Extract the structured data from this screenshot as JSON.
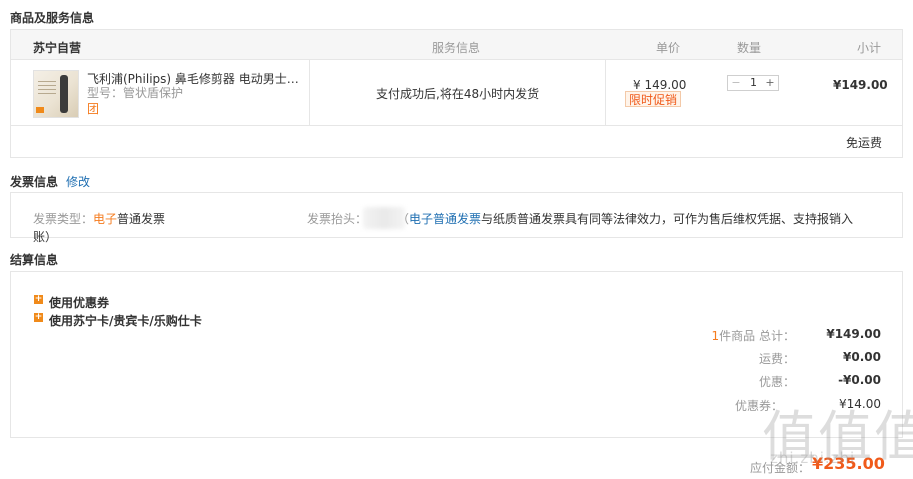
{
  "goods_section": {
    "title": "商品及服务信息",
    "store_name": "苏宁自营",
    "headers": {
      "service": "服务信息",
      "price": "单价",
      "quantity": "数量",
      "subtotal": "小计"
    },
    "item": {
      "name": "飞利浦(Philips) 鼻毛修剪器 电动男士…",
      "model": "型号：管状盾保护",
      "group_tag": "团",
      "service": "支付成功后,将在48小时内发货",
      "price": "¥ 149.00",
      "promo": "限时促销",
      "qty_minus": "−",
      "qty": "1",
      "qty_plus": "+",
      "subtotal": "¥149.00"
    },
    "shipping": "免运费"
  },
  "invoice_section": {
    "title": "发票信息",
    "edit_link": "修改",
    "type_label": "发票类型：",
    "type_value_highlight": "电子",
    "type_value_rest": "普通发票",
    "header_label": "发票抬头：",
    "header_paren": "（",
    "desc_link": "电子普通发票",
    "desc_rest": "与纸质普通发票具有同等法律效力，可作为售后维权凭据、支持报销入",
    "desc_wrap": "账）"
  },
  "settlement_section": {
    "title": "结算信息",
    "coupon": "使用优惠券",
    "card": "使用苏宁卡/贵宾卡/乐购仕卡",
    "item_count_num": "1",
    "item_count_label": "件商品 总计：",
    "total": "¥149.00",
    "freight_label": "运费：",
    "freight": "¥0.00",
    "discount_label": "优惠：",
    "discount": "-¥0.00",
    "coupon_label": "优惠券：",
    "coupon_value": "¥14.00"
  },
  "footer": {
    "payable_label": "应付金额：",
    "payable": "¥235.00"
  },
  "watermark": {
    "big": "值值值",
    "small": "zhi.zhi.zhi"
  },
  "colors": {
    "accent": "#f57c1f",
    "link": "#1f6fb2",
    "border": "#e6e6e6",
    "header_bg": "#f6f6f6",
    "promo_red": "#f05a1a"
  }
}
